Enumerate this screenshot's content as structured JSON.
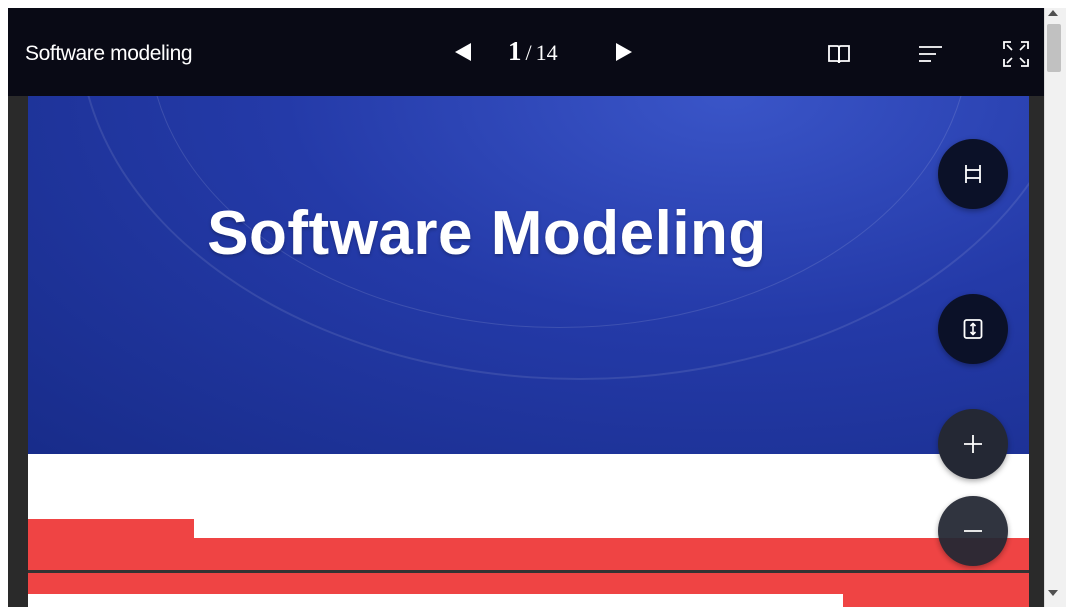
{
  "toolbar": {
    "document_title": "Software modeling",
    "page_current": "1",
    "page_separator": "/",
    "page_total": "14",
    "icons": {
      "prev": "triangle-left-icon",
      "next": "triangle-right-icon",
      "book": "open-book-icon",
      "menu": "menu-lines-icon",
      "fullscreen": "fullscreen-icon"
    }
  },
  "slide": {
    "title": "Software Modeling",
    "colors": {
      "blue": "#243aa8",
      "red": "#ef4444",
      "white": "#ffffff"
    }
  },
  "floating_controls": {
    "fit_width_icon": "fit-width-icon",
    "fit_height_icon": "fit-height-icon",
    "zoom_in_icon": "plus-icon",
    "zoom_out_icon": "minus-icon"
  }
}
